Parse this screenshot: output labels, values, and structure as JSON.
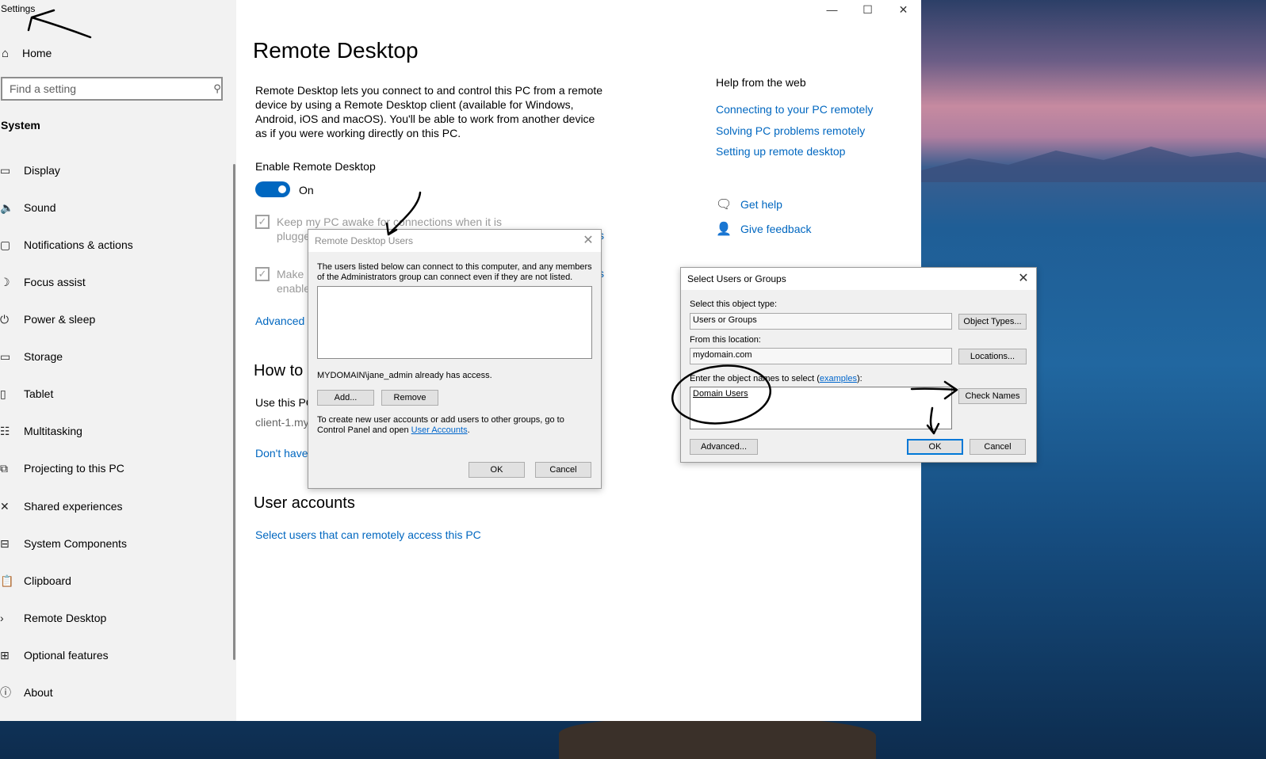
{
  "window": {
    "title": "Settings",
    "minimize": "—",
    "maximize": "☐",
    "close": "✕"
  },
  "sidebar": {
    "home_label": "Home",
    "search_placeholder": "Find a setting",
    "section_title": "System",
    "items": [
      {
        "label": "Display",
        "icon": "display-icon",
        "glyph": "▭"
      },
      {
        "label": "Sound",
        "icon": "speaker-icon",
        "glyph": "🔈"
      },
      {
        "label": "Notifications & actions",
        "icon": "notification-icon",
        "glyph": "▢"
      },
      {
        "label": "Focus assist",
        "icon": "moon-icon",
        "glyph": "☽"
      },
      {
        "label": "Power & sleep",
        "icon": "power-icon",
        "glyph": "⏻"
      },
      {
        "label": "Storage",
        "icon": "storage-icon",
        "glyph": "▭"
      },
      {
        "label": "Tablet",
        "icon": "tablet-icon",
        "glyph": "▯"
      },
      {
        "label": "Multitasking",
        "icon": "multitasking-icon",
        "glyph": "☷"
      },
      {
        "label": "Projecting to this PC",
        "icon": "projecting-icon",
        "glyph": "⧉"
      },
      {
        "label": "Shared experiences",
        "icon": "shared-icon",
        "glyph": "✕"
      },
      {
        "label": "System Components",
        "icon": "components-icon",
        "glyph": "⊟"
      },
      {
        "label": "Clipboard",
        "icon": "clipboard-icon",
        "glyph": "📋"
      },
      {
        "label": "Remote Desktop",
        "icon": "remote-desktop-icon",
        "glyph": "›"
      },
      {
        "label": "Optional features",
        "icon": "features-icon",
        "glyph": "⊞"
      },
      {
        "label": "About",
        "icon": "info-icon",
        "glyph": "ⓘ"
      }
    ]
  },
  "main": {
    "title": "Remote Desktop",
    "description": "Remote Desktop lets you connect to and control this PC from a remote device by using a Remote Desktop client (available for Windows, Android, iOS and macOS). You'll be able to work from another device as if you were working directly on this PC.",
    "enable_label": "Enable Remote Desktop",
    "toggle_state": "On",
    "keep_awake_line1": "Keep my PC awake for connections when it is",
    "keep_awake_line2": "plugge",
    "make_line1": "Make",
    "make_line2": "enable",
    "show_settings_1": "s",
    "show_settings_2": "s",
    "advanced_link": "Advanced s",
    "how_to_heading": "How to",
    "use_this_pc": "Use this PC",
    "pc_name": "client-1.myc",
    "dont_have": "Don't have",
    "user_accounts_heading": "User accounts",
    "select_users_link": "Select users that can remotely access this PC"
  },
  "help": {
    "heading": "Help from the web",
    "links": [
      "Connecting to your PC remotely",
      "Solving PC problems remotely",
      "Setting up remote desktop"
    ],
    "get_help": "Get help",
    "give_feedback": "Give feedback"
  },
  "rdu_dialog": {
    "title": "Remote Desktop Users",
    "info": "The users listed below can connect to this computer, and any members of the Administrators group can connect even if they are not listed.",
    "access_note": "MYDOMAIN\\jane_admin already has access.",
    "add_button": "Add...",
    "remove_button": "Remove",
    "footer_text": "To create new user accounts or add users to other groups, go to Control Panel and open ",
    "footer_link": "User Accounts",
    "footer_end": ".",
    "ok_button": "OK",
    "cancel_button": "Cancel"
  },
  "select_dialog": {
    "title": "Select Users or Groups",
    "object_type_label": "Select this object type:",
    "object_type_value": "Users or Groups",
    "object_types_button": "Object Types...",
    "location_label": "From this location:",
    "location_value": "mydomain.com",
    "locations_button": "Locations...",
    "names_label_prefix": "Enter the object names to select (",
    "names_label_link": "examples",
    "names_label_suffix": "):",
    "names_value": "Domain Users",
    "check_names_button": "Check Names",
    "advanced_button": "Advanced...",
    "ok_button": "OK",
    "cancel_button": "Cancel"
  },
  "colors": {
    "accent": "#0067c0",
    "sidebar_bg": "#f2f2f2",
    "dialog_bg": "#f0f0f0"
  }
}
